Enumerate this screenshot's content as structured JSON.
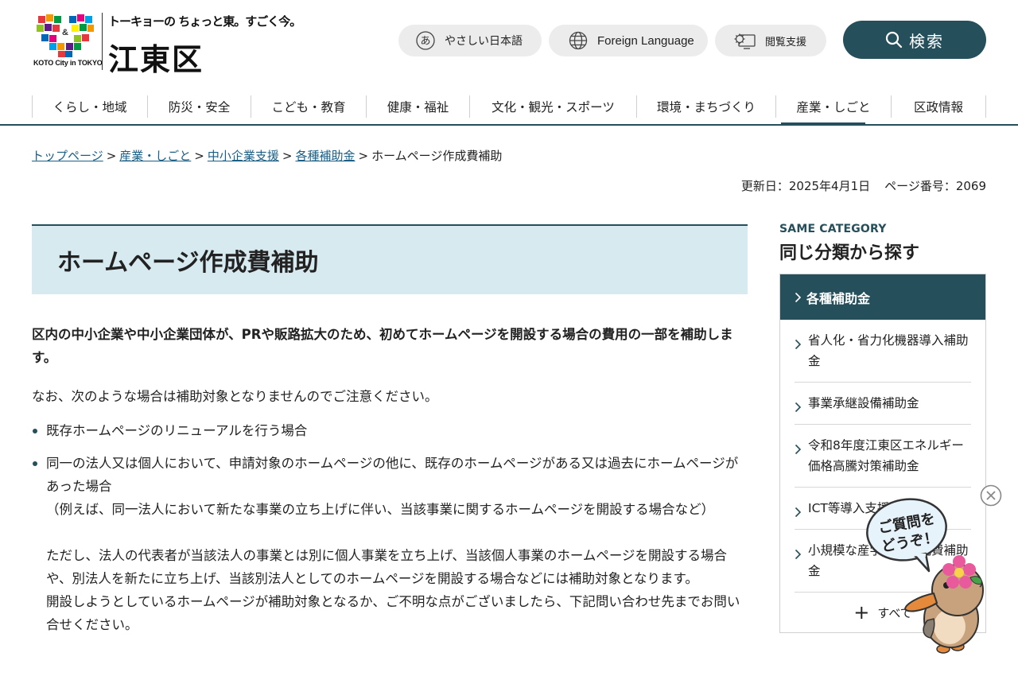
{
  "header": {
    "logo": {
      "caption": "KOTO City in TOKYO",
      "tagline": "トーキョーの ちょっと東。すごく今。",
      "name": "江東区"
    },
    "buttons": {
      "easy_japanese": "やさしい日本語",
      "easy_japanese_icon_char": "あ",
      "foreign_language": "Foreign Language",
      "browsing_support": "閲覧支援",
      "search": "検索"
    },
    "icons": [
      "hiragana-a-icon",
      "globe-icon",
      "gear-monitor-icon",
      "search-icon"
    ]
  },
  "nav": {
    "items": [
      {
        "label": "くらし・地域"
      },
      {
        "label": "防災・安全"
      },
      {
        "label": "こども・教育"
      },
      {
        "label": "健康・福祉"
      },
      {
        "label": "文化・観光・スポーツ"
      },
      {
        "label": "環境・まちづくり"
      },
      {
        "label": "産業・しごと",
        "active": true
      },
      {
        "label": "区政情報"
      }
    ]
  },
  "breadcrumb": {
    "links": [
      "トップページ",
      "産業・しごと",
      "中小企業支援",
      "各種補助金"
    ],
    "current": "ホームページ作成費補助",
    "separator": ">"
  },
  "meta": {
    "updated": "更新日：2025年4月1日",
    "page_number": "ページ番号：2069"
  },
  "main": {
    "title": "ホームページ作成費補助",
    "lead": "区内の中小企業や中小企業団体が、PRや販路拡大のため、初めてホームページを開設する場合の費用の一部を補助します。",
    "note": "なお、次のような場合は補助対象となりませんのでご注意ください。",
    "bullets": [
      {
        "text": "既存ホームページのリニューアルを行う場合"
      },
      {
        "text": "同一の法人又は個人において、申請対象のホームページの他に、既存のホームページがある又は過去にホームページがあった場合",
        "example": "（例えば、同一法人において新たな事業の立ち上げに伴い、当該事業に関するホームページを開設する場合など）",
        "however": "ただし、法人の代表者が当該法人の事業とは別に個人事業を立ち上げ、当該個人事業のホームページを開設する場合や、別法人を新たに立ち上げ、当該別法人としてのホームページを開設する場合などには補助対象となります。",
        "contact": "開設しようとしているホームページが補助対象となるか、ご不明な点がございましたら、下記問い合わせ先までお問い合せください。"
      }
    ]
  },
  "sidebar": {
    "label": "SAME CATEGORY",
    "title": "同じ分類から探す",
    "head": "各種補助金",
    "items": [
      {
        "label": "省人化・省力化機器導入補助金"
      },
      {
        "label": "事業承継設備補助金"
      },
      {
        "label": "令和8年度江東区エネルギー価格高騰対策補助金"
      },
      {
        "label": "ICT等導入支援"
      },
      {
        "label": "小規模な産学連携研究費補助金"
      }
    ],
    "all_label": "すべて"
  },
  "chatbot": {
    "bubble_line1": "ご質問を",
    "bubble_line2": "どうぞ！"
  },
  "colors": {
    "primary": "#254f5a",
    "title_bg": "#d7eaf0",
    "link": "#1a5f86",
    "button_bg": "#ececec"
  }
}
